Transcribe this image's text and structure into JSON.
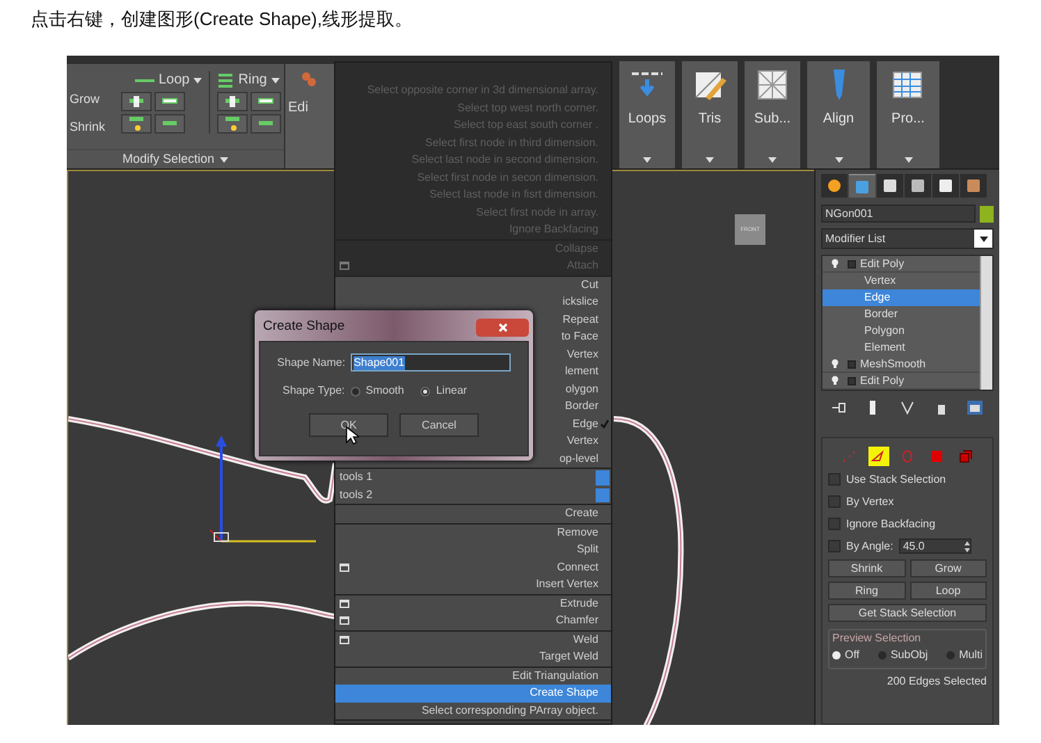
{
  "caption": "点击右键，创建图形(Create Shape),线形提取。",
  "ribbon": {
    "modify_selection": {
      "loop": "Loop",
      "ring": "Ring",
      "grow": "Grow",
      "shrink": "Shrink",
      "footer": "Modify Selection"
    },
    "edit_label": "Edi",
    "panels": [
      {
        "label": "Loops"
      },
      {
        "label": "Tris"
      },
      {
        "label": "Sub..."
      },
      {
        "label": "Align"
      },
      {
        "label": "Pro..."
      }
    ]
  },
  "viewport": {
    "viewcube_label": "FRONT"
  },
  "context_menu": {
    "sections": [
      {
        "disabled": true,
        "items": [
          {
            "label": "Select opposite corner in 3d dimensional array.",
            "kind": "item"
          },
          {
            "label": "Select top west north corner.",
            "kind": "item"
          },
          {
            "label": "Select top east south corner .",
            "kind": "item"
          },
          {
            "label": "Select first node in third dimension.",
            "kind": "item"
          },
          {
            "label": "Select last node in second dimension.",
            "kind": "item"
          },
          {
            "label": "Select first node in secon dimension.",
            "kind": "item"
          },
          {
            "label": "Select last node in fisrt dimension.",
            "kind": "item"
          },
          {
            "label": "Select first node in array.",
            "kind": "item"
          },
          {
            "label": "Ignore Backfacing",
            "kind": "item"
          }
        ]
      },
      {
        "disabled": true,
        "items": [
          {
            "label": "Collapse",
            "kind": "item"
          },
          {
            "label": "Attach",
            "kind": "option"
          }
        ]
      },
      {
        "disabled": false,
        "items": [
          {
            "label": "Cut",
            "kind": "item",
            "checked": false
          },
          {
            "label": "ickslice",
            "kind": "item",
            "checked": false
          },
          {
            "label": "Repeat",
            "kind": "item",
            "checked": false
          },
          {
            "label": "to Face",
            "kind": "item",
            "checked": false
          },
          {
            "label": "Vertex",
            "kind": "item",
            "checked": false
          },
          {
            "label": "lement",
            "kind": "item",
            "checked": false
          },
          {
            "label": "olygon",
            "kind": "item",
            "checked": false
          },
          {
            "label": "Border",
            "kind": "item",
            "checked": false
          },
          {
            "label": "Edge",
            "kind": "item",
            "checked": true
          },
          {
            "label": "Vertex",
            "kind": "item",
            "checked": false
          },
          {
            "label": "op-level",
            "kind": "item",
            "checked": false
          }
        ]
      },
      {
        "disabled": false,
        "items": [
          {
            "label": "tools 1",
            "kind": "quadrant"
          },
          {
            "label": "tools 2",
            "kind": "quadrant"
          }
        ]
      },
      {
        "disabled": false,
        "items": [
          {
            "label": "Create",
            "kind": "item"
          }
        ]
      },
      {
        "disabled": false,
        "items": [
          {
            "label": "Remove",
            "kind": "item"
          },
          {
            "label": "Split",
            "kind": "item"
          },
          {
            "label": "Connect",
            "kind": "option"
          },
          {
            "label": "Insert Vertex",
            "kind": "item"
          }
        ]
      },
      {
        "disabled": false,
        "items": [
          {
            "label": "Extrude",
            "kind": "option"
          },
          {
            "label": "Chamfer",
            "kind": "option"
          }
        ]
      },
      {
        "disabled": false,
        "items": [
          {
            "label": "Weld",
            "kind": "option"
          },
          {
            "label": "Target Weld",
            "kind": "item"
          }
        ]
      },
      {
        "disabled": false,
        "items": [
          {
            "label": "Edit Triangulation",
            "kind": "item",
            "selected": false
          },
          {
            "label": "Create Shape",
            "kind": "item",
            "selected": true
          },
          {
            "label": "Select corresponding PArray object.",
            "kind": "item",
            "selected": false
          }
        ]
      }
    ]
  },
  "dialog": {
    "title": "Create Shape",
    "name_label": "Shape Name:",
    "name_value": "Shape001",
    "type_label": "Shape Type:",
    "options": [
      {
        "label": "Smooth",
        "selected": false
      },
      {
        "label": "Linear",
        "selected": true
      }
    ],
    "buttons": [
      "OK",
      "Cancel"
    ]
  },
  "command_panel": {
    "tabs": [
      {
        "selected": false
      },
      {
        "selected": true
      },
      {
        "selected": false
      },
      {
        "selected": false
      },
      {
        "selected": false
      },
      {
        "selected": false
      }
    ],
    "object_name": "NGon001",
    "modifier_list": "Modifier List",
    "stack": [
      {
        "label": "Edit Poly",
        "children": [
          {
            "label": "Vertex",
            "selected": false
          },
          {
            "label": "Edge",
            "selected": true
          },
          {
            "label": "Border",
            "selected": false
          },
          {
            "label": "Polygon",
            "selected": false
          },
          {
            "label": "Element",
            "selected": false
          }
        ]
      },
      {
        "label": "MeshSmooth"
      },
      {
        "label": "Edit Poly"
      }
    ],
    "subobjects": [
      {
        "selected": false
      },
      {
        "selected": true
      },
      {
        "selected": false
      },
      {
        "selected": false
      },
      {
        "selected": false
      }
    ],
    "checkboxes": [
      {
        "label": "Use Stack Selection",
        "checked": false
      },
      {
        "label": "By Vertex",
        "checked": false
      },
      {
        "label": "Ignore Backfacing",
        "checked": false
      },
      {
        "label": "By Angle:",
        "checked": false
      }
    ],
    "angle_value": "45.0",
    "shrink": "Shrink",
    "grow": "Grow",
    "ring": "Ring",
    "loop": "Loop",
    "get_stack": "Get Stack Selection",
    "preview": {
      "title": "Preview Selection",
      "options": [
        {
          "label": "Off",
          "selected": true
        },
        {
          "label": "SubObj",
          "selected": false
        },
        {
          "label": "Multi",
          "selected": false
        }
      ]
    },
    "status": "200 Edges Selected"
  }
}
